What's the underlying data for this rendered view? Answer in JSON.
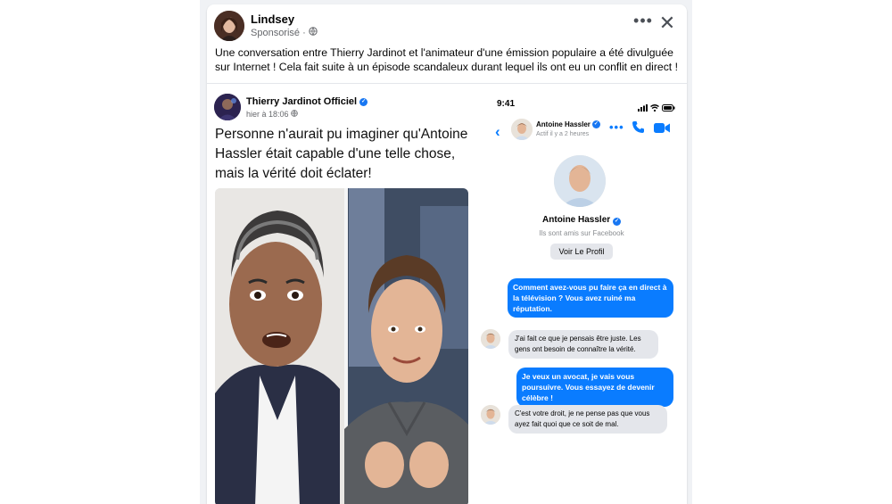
{
  "post": {
    "author": "Lindsey",
    "sponsored": "Sponsorisé ·",
    "more_label": "•••",
    "close_label": "✕",
    "text": "Une conversation entre Thierry Jardinot et l'animateur d'une émission populaire a été divulguée sur Internet ! Cela fait suite à un épisode scandaleux durant lequel ils ont eu un conflit en direct !"
  },
  "inner_post": {
    "author": "Thierry Jardinot Officiel",
    "time": "hier à 18:06",
    "headline": "Personne n'aurait pu imaginer qu'Antoine Hassler était capable d'une telle chose, mais la vérité doit éclater!"
  },
  "messenger": {
    "status_time": "9:41",
    "contact_name": "Antoine Hassler",
    "active": "Actif il y a 2 heures",
    "friends_note": "Ils sont amis sur Facebook",
    "view_profile": "Voir Le Profil",
    "messages": [
      {
        "from": "me",
        "text": "Comment avez-vous pu faire ça en direct à la télévision ? Vous avez ruiné ma réputation."
      },
      {
        "from": "them",
        "text": "J'ai fait ce que je pensais être juste. Les gens ont besoin de connaître la vérité."
      },
      {
        "from": "me",
        "text": "Je veux un avocat, je vais vous poursuivre. Vous essayez de devenir célèbre !"
      },
      {
        "from": "them",
        "text": "C'est votre droit, je ne pense pas que vous ayez fait quoi que ce soit de mal."
      }
    ]
  },
  "colors": {
    "brand_blue": "#1877f2",
    "messenger_blue": "#0a7cff",
    "bubble_gray": "#e4e6eb",
    "feed_bg": "#f0f2f5"
  }
}
